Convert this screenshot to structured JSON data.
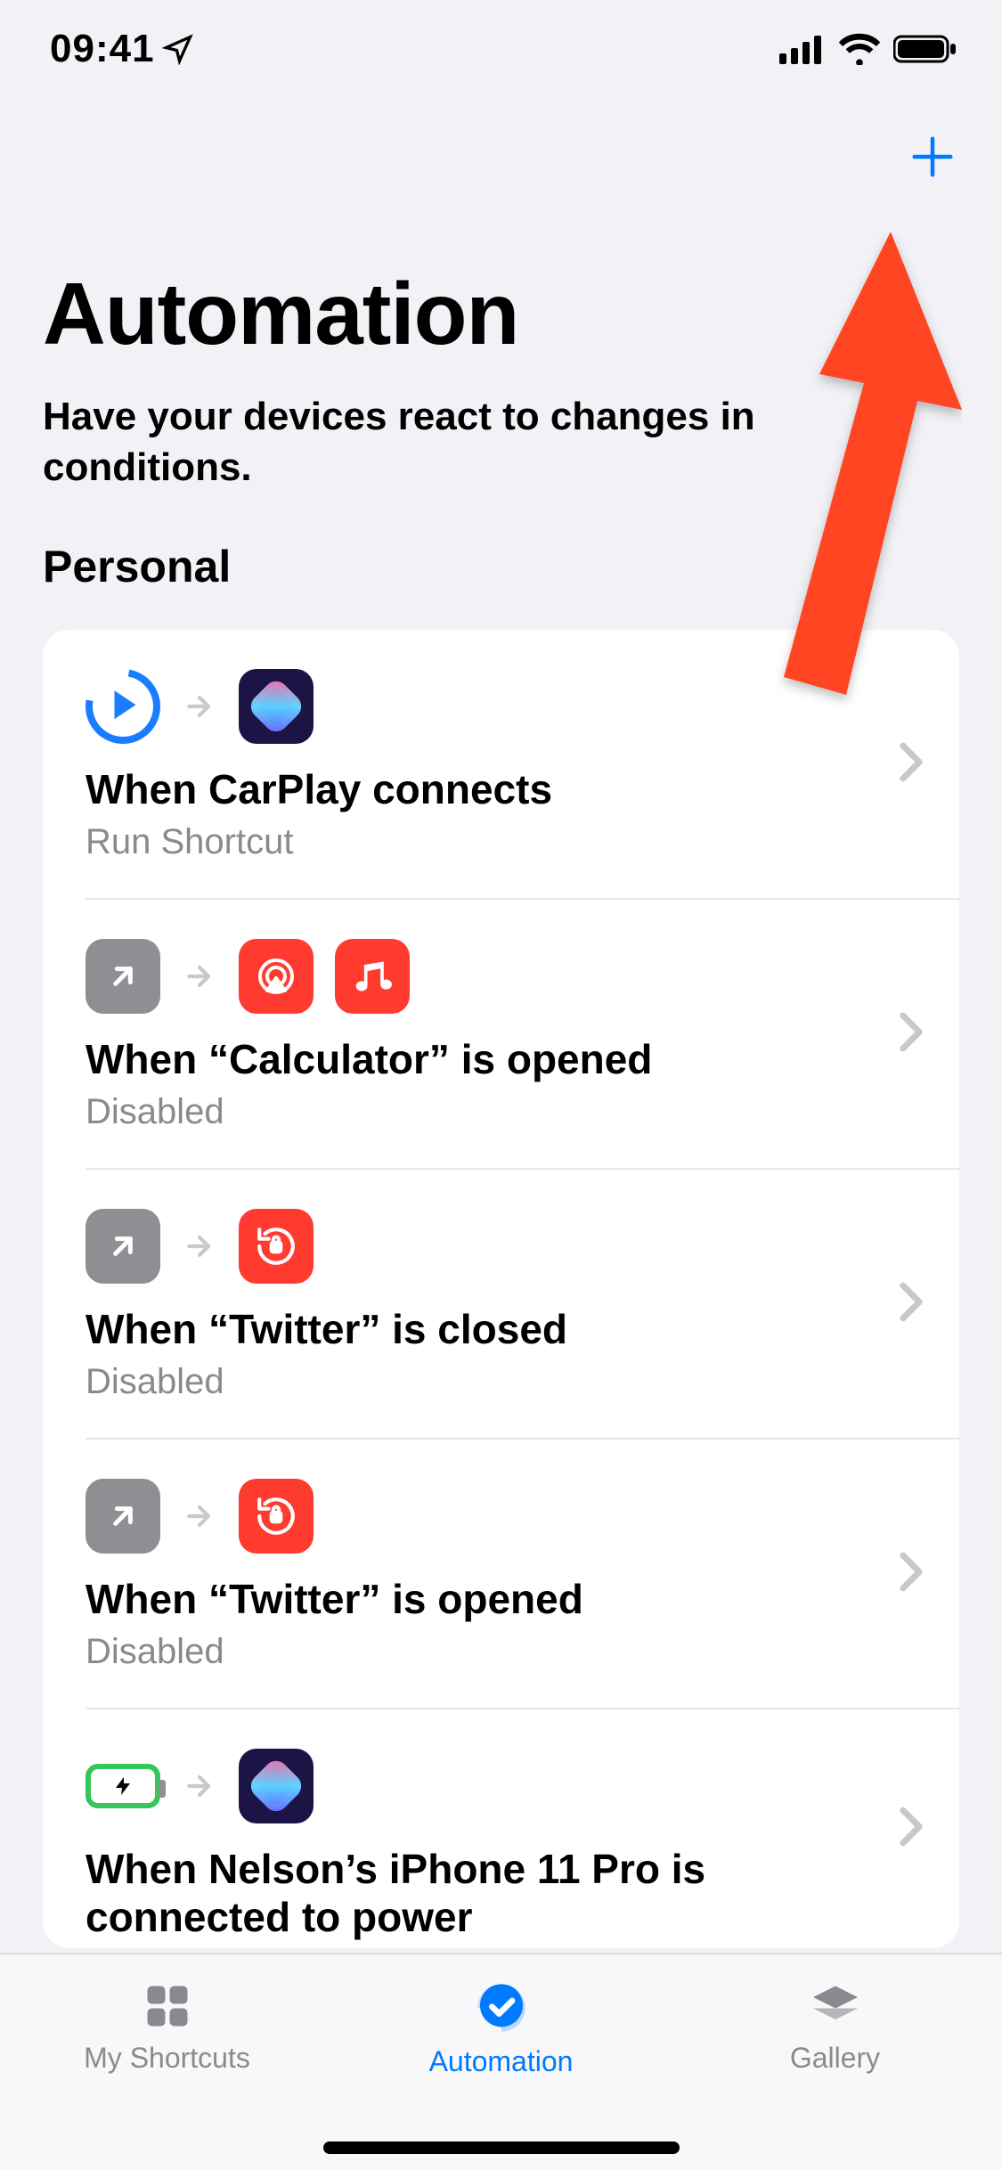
{
  "status": {
    "time": "09:41"
  },
  "nav": {
    "add": "+"
  },
  "page": {
    "title": "Automation",
    "subtitle": "Have your devices react to changes in conditions."
  },
  "section": {
    "personal": "Personal"
  },
  "items": [
    {
      "title": "When CarPlay connects",
      "subtitle": "Run Shortcut"
    },
    {
      "title": "When “Calculator” is opened",
      "subtitle": "Disabled"
    },
    {
      "title": "When “Twitter” is closed",
      "subtitle": "Disabled"
    },
    {
      "title": "When “Twitter” is opened",
      "subtitle": "Disabled"
    },
    {
      "title": "When Nelson’s iPhone 11 Pro is connected to power",
      "subtitle": ""
    }
  ],
  "tabs": {
    "shortcuts": "My Shortcuts",
    "automation": "Automation",
    "gallery": "Gallery"
  }
}
